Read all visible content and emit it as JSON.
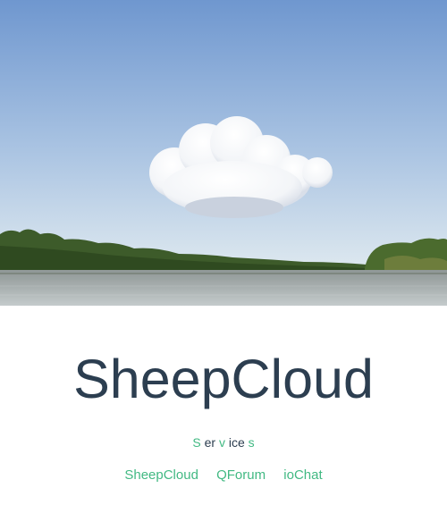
{
  "hero": {
    "image": "sky-cloud-river-landscape"
  },
  "brand": {
    "title": "SheepCloud"
  },
  "services": {
    "parts": [
      "S",
      "er",
      "v",
      "ice",
      "s"
    ]
  },
  "nav": {
    "links": [
      "SheepCloud",
      "QForum",
      "ioChat"
    ]
  },
  "colors": {
    "accent": "#42b983",
    "text": "#2c3e50",
    "sky_top": "#6f97cf",
    "sky_bottom": "#dfe9ef"
  }
}
